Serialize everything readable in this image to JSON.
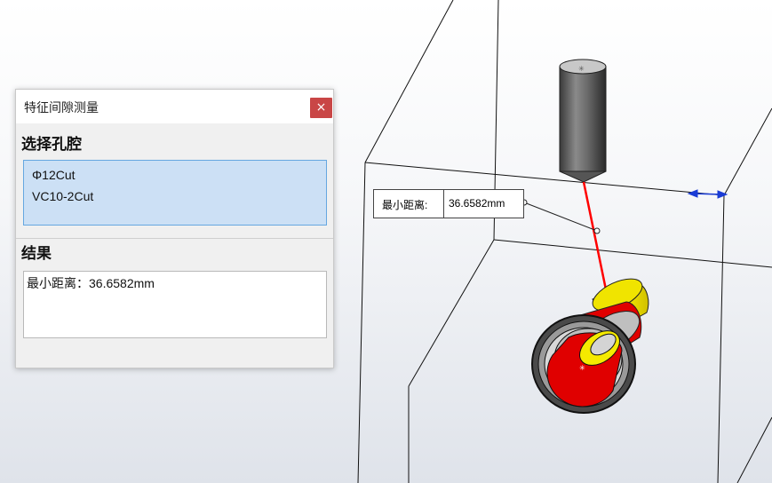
{
  "dialog": {
    "title": "特征间隙测量",
    "close_glyph": "×",
    "select_section_title": "选择孔腔",
    "selected_items": [
      "Φ12Cut",
      "VC10-2Cut"
    ],
    "result_section_title": "结果",
    "result_text": "最小距离：36.6582mm"
  },
  "callout": {
    "label": "最小距离:",
    "value": "36.6582mm"
  },
  "colors": {
    "close_button": "#c94646",
    "selection_bg": "#cce0f5",
    "measure_line": "#ff0000",
    "yellow_ring": "#f2e600",
    "red_ring": "#e00000"
  }
}
